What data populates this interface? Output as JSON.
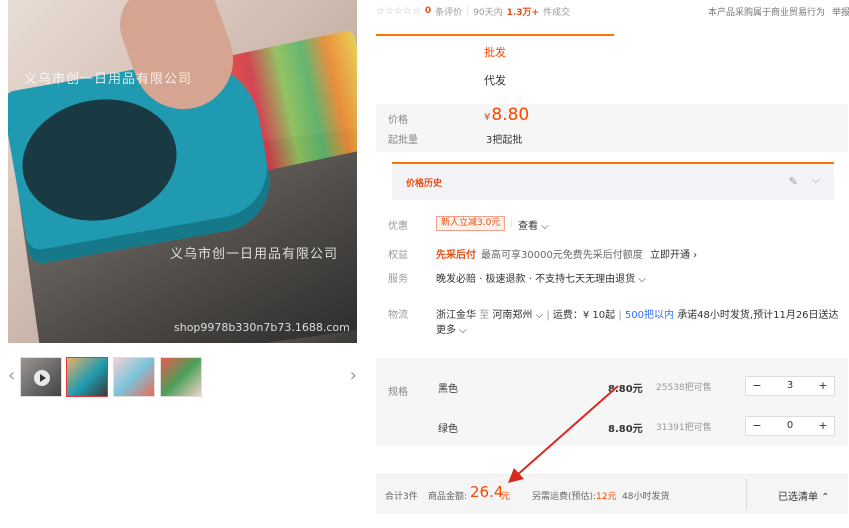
{
  "gallery": {
    "watermark_1": "义乌市创一日用品有限公司",
    "watermark_2": "义乌市创一日用品有限公司",
    "watermark_url": "shop9978b330n7b73.1688.com",
    "prev_icon": "chevron-left-icon",
    "next_icon": "chevron-right-icon",
    "prev_glyph": "‹",
    "next_glyph": "›"
  },
  "rating": {
    "stars": "☆☆☆☆☆",
    "review_count": "0",
    "review_label": "条评价",
    "sales_period": "90天内",
    "sales_count": "1.3万+",
    "sales_label": "件成交"
  },
  "header": {
    "disclaimer": "本产品采购属于商业贸易行为",
    "report": "举报"
  },
  "mode_tabs": {
    "wholesale": "批发",
    "dropship": "代发"
  },
  "price": {
    "label": "价格",
    "currency": "¥",
    "value": "8.80",
    "moq_label": "起批量",
    "moq_value": "3把起批"
  },
  "price_history": {
    "title": "价格历史",
    "edit_icon": "✎",
    "collapse_icon": "⌵"
  },
  "promotion": {
    "label": "优惠",
    "badge": "新人立减3.0元",
    "view": "查看 ⌵"
  },
  "benefit": {
    "label": "权益",
    "tag": "先采后付",
    "text": "最高可享30000元免费先采后付额度",
    "action": "立即开通 ›"
  },
  "service": {
    "label": "服务",
    "text": "晚发必赔 · 极速退款 · 不支持七天无理由退货 ⌵"
  },
  "logistics": {
    "label": "物流",
    "from": "浙江金华",
    "to_word": "至",
    "to": "河南郑州 ⌵",
    "fee": "运费：¥ 10起",
    "qty_range": "500把以内",
    "promise": "承诺48小时发货,预计11月26日送达",
    "more": "更多 ⌵"
  },
  "sku": {
    "label": "规格",
    "items": [
      {
        "name": "黑色",
        "price": "8.80元",
        "stock": "25538把可售",
        "qty": "3"
      },
      {
        "name": "绿色",
        "price": "8.80元",
        "stock": "31391把可售",
        "qty": "0"
      }
    ],
    "minus": "−",
    "plus": "+"
  },
  "footer": {
    "total_count": "合计3件",
    "amount_label": "商品金额:",
    "amount_value": "26.4",
    "amount_unit": "元",
    "shipping_label": "另需运费(预估):",
    "shipping_value": "12元",
    "ship_time": "48小时发货",
    "selected_list": "已选清单 ⌃"
  },
  "colors": {
    "accent": "#ff4400",
    "tab_line": "#ff7300",
    "annotation_arrow": "#d9281e"
  }
}
